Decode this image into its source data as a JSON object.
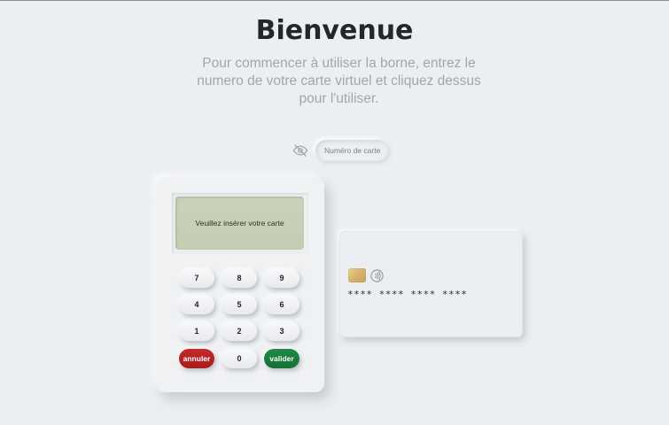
{
  "header": {
    "title": "Bienvenue",
    "subtitle": "Pour commencer à utiliser la borne, entrez le numero de votre carte virtuel et cliquez dessus pour l'utiliser."
  },
  "card_input": {
    "placeholder": "Numéro de carte",
    "value": "",
    "visibility_icon": "eye-off-icon"
  },
  "terminal": {
    "screen_message": "Veuillez insérer votre carte",
    "keys": [
      "7",
      "8",
      "9",
      "4",
      "5",
      "6",
      "1",
      "2",
      "3",
      "annuler",
      "0",
      "valider"
    ],
    "colors": {
      "cancel": "#b52222",
      "validate": "#1b7d3e",
      "screen": "#c6d0b6"
    }
  },
  "virtual_card": {
    "number": "**** **** **** ****",
    "chip_icon": "chip-icon",
    "contactless_icon": "contactless-icon"
  }
}
